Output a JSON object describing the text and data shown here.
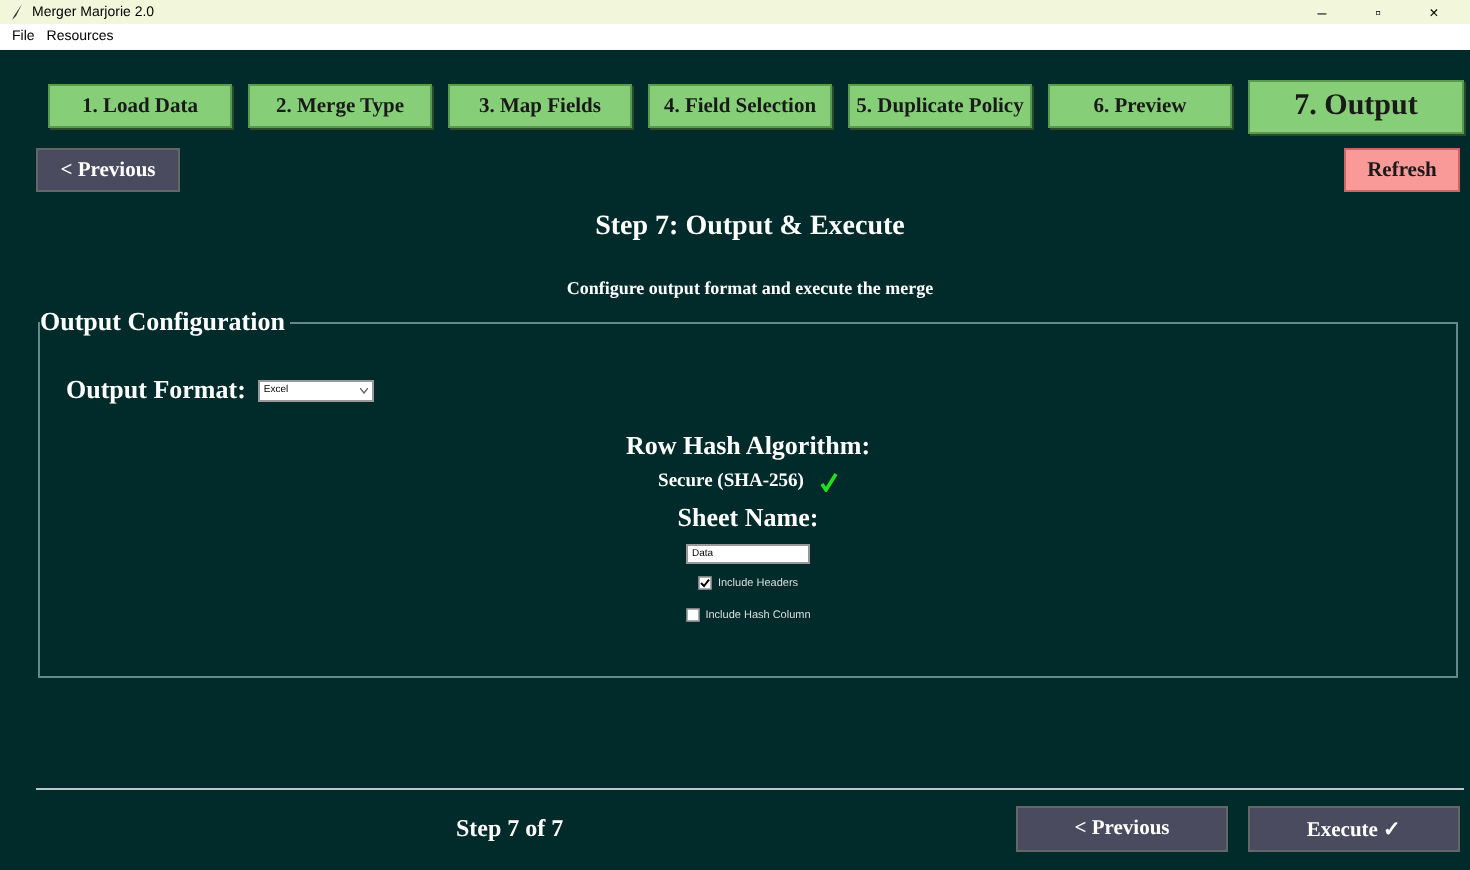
{
  "window": {
    "title": "Merger Marjorie 2.0",
    "controls": [
      "–",
      "▫",
      "×"
    ]
  },
  "menu": [
    "File",
    "Resources"
  ],
  "tabs": [
    {
      "label": "1. Load Data",
      "selected": false
    },
    {
      "label": "2. Merge Type",
      "selected": false
    },
    {
      "label": "3. Map Fields",
      "selected": false
    },
    {
      "label": "4. Field Selection",
      "selected": false
    },
    {
      "label": "5. Duplicate Policy",
      "selected": false
    },
    {
      "label": "6. Preview",
      "selected": false
    },
    {
      "label": "7. Output",
      "selected": true
    }
  ],
  "nav": {
    "previous": "< Previous",
    "refresh": "Refresh"
  },
  "heading": "Step 7: Output & Execute",
  "subheading": "Configure output format and execute the merge",
  "config": {
    "legend": "Output Configuration",
    "format_label": "Output Format:",
    "format_value": "Excel",
    "hash_label": "Row Hash Algorithm:",
    "hash_value": "Secure (SHA-256)",
    "sheet_label": "Sheet Name:",
    "sheet_value": "Data",
    "options": [
      {
        "label": "Include Headers",
        "checked": true
      },
      {
        "label": "Include Hash Column",
        "checked": false
      }
    ]
  },
  "footer": {
    "step": "Step 7 of 7",
    "previous": "< Previous",
    "execute": "Execute ✓"
  }
}
